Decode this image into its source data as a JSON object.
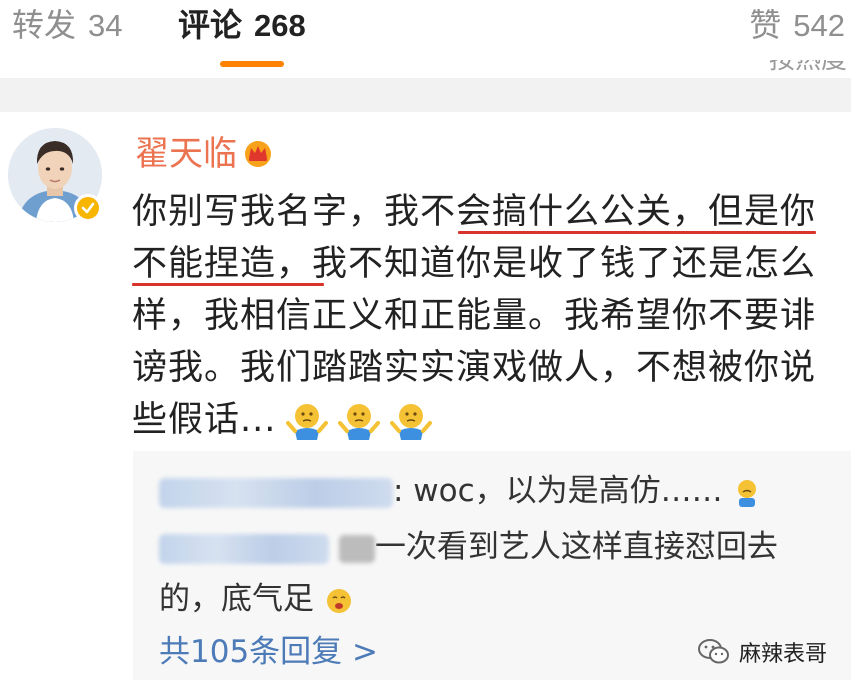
{
  "tabs": {
    "repost": {
      "label": "转发",
      "count": "34"
    },
    "comment": {
      "label": "评论",
      "count": "268"
    },
    "like": {
      "label": "赞",
      "count": "542"
    }
  },
  "sort_hint": "按热度",
  "colors": {
    "accent": "#ff8200",
    "username": "#eb7350",
    "link": "#4c7bb8",
    "underline": "#d9342b",
    "verified": "#f7b500"
  },
  "comment": {
    "username": "翟天临",
    "lines": [
      {
        "a": "你别写我名字，我不",
        "b": "会搞什么公关，但是你"
      },
      {
        "a": "不能捏造，",
        "b": "我不知道你是收了钱了还是怎么"
      },
      {
        "t": "样，我相信正义和正能量。我希望你不要诽"
      },
      {
        "t": "谤我。我们踏踏实实演戏做人，不想被你说"
      },
      {
        "t": "些假话..."
      }
    ],
    "emojis": [
      "shrug-emoji",
      "shrug-emoji",
      "shrug-emoji"
    ]
  },
  "replies": {
    "items": [
      {
        "text": ": woc，以为是高仿……"
      },
      {
        "text": "一次看到艺人这样直接怼回去",
        "cont": "的，底气足"
      }
    ],
    "more_label": "共105条回复 >"
  },
  "watermark": {
    "text": "麻辣表哥"
  }
}
